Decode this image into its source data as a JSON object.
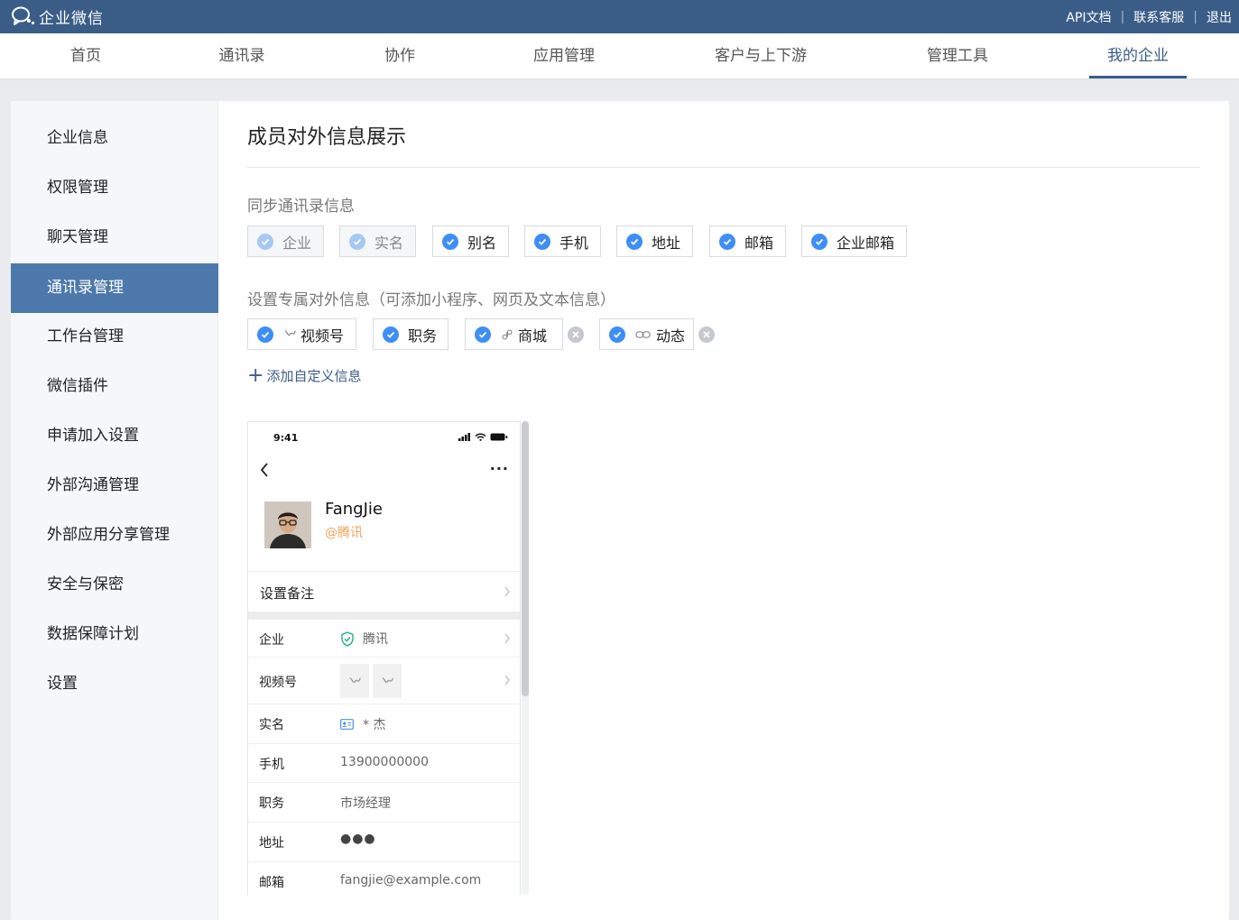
{
  "brand": {
    "name": "企业微信"
  },
  "toplinks": {
    "api": "API文档",
    "support": "联系客服",
    "logout": "退出"
  },
  "nav": [
    "首页",
    "通讯录",
    "协作",
    "应用管理",
    "客户与上下游",
    "管理工具",
    "我的企业"
  ],
  "nav_active": "我的企业",
  "sidebar": [
    "企业信息",
    "权限管理",
    "聊天管理",
    "通讯录管理",
    "工作台管理",
    "微信插件",
    "申请加入设置",
    "外部沟通管理",
    "外部应用分享管理",
    "安全与保密",
    "数据保障计划",
    "设置"
  ],
  "sidebar_active": "通讯录管理",
  "page": {
    "title": "成员对外信息展示",
    "sync_title": "同步通讯录信息",
    "sync_fields": [
      {
        "label": "企业",
        "checked": true,
        "disabled": true
      },
      {
        "label": "实名",
        "checked": true,
        "disabled": true
      },
      {
        "label": "别名",
        "checked": true,
        "disabled": false
      },
      {
        "label": "手机",
        "checked": true,
        "disabled": false
      },
      {
        "label": "地址",
        "checked": true,
        "disabled": false
      },
      {
        "label": "邮箱",
        "checked": true,
        "disabled": false
      },
      {
        "label": "企业邮箱",
        "checked": true,
        "disabled": false
      }
    ],
    "custom_title": "设置专属对外信息（可添加小程序、网页及文本信息）",
    "custom_fields": [
      {
        "label": "视频号",
        "icon": "channels-icon",
        "removable": false
      },
      {
        "label": "职务",
        "icon": "",
        "removable": false
      },
      {
        "label": "商城",
        "icon": "miniprogram-icon",
        "removable": true
      },
      {
        "label": "动态",
        "icon": "link-icon",
        "removable": true
      }
    ],
    "add_custom": "添加自定义信息"
  },
  "preview": {
    "time": "9:41",
    "name": "FangJie",
    "corp": "@腾讯",
    "remark": "设置备注",
    "rows": {
      "company": {
        "label": "企业",
        "value": "腾讯"
      },
      "channels": {
        "label": "视频号"
      },
      "realname": {
        "label": "实名",
        "value": "* 杰"
      },
      "mobile": {
        "label": "手机",
        "value": "13900000000"
      },
      "title": {
        "label": "职务",
        "value": "市场经理"
      },
      "address": {
        "label": "地址",
        "value": "●●●"
      },
      "email": {
        "label": "邮箱",
        "value": "fangjie@example.com"
      }
    }
  },
  "colors": {
    "header": "#3a5d88",
    "accent": "#3e8ef7",
    "sidebar_active": "#4d78ab"
  }
}
